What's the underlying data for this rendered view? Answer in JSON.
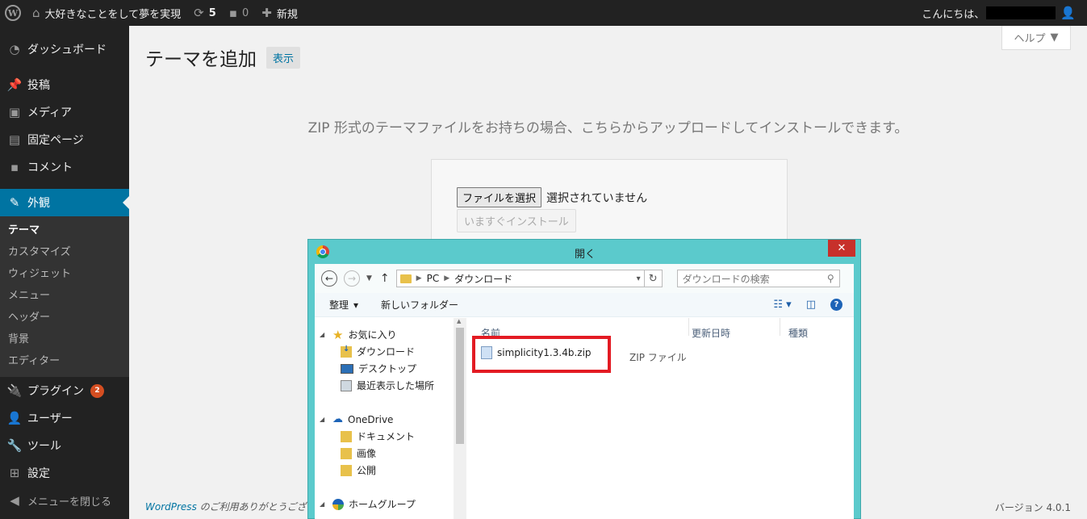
{
  "adminbar": {
    "site_name": "大好きなことをして夢を実現",
    "updates_count": "5",
    "comments_count": "0",
    "new_label": "新規",
    "greeting": "こんにちは、"
  },
  "sidebar": {
    "items": [
      {
        "label": "ダッシュボード",
        "icon": "dashboard-icon"
      },
      {
        "label": "投稿",
        "icon": "pin-icon"
      },
      {
        "label": "メディア",
        "icon": "media-icon"
      },
      {
        "label": "固定ページ",
        "icon": "page-icon"
      },
      {
        "label": "コメント",
        "icon": "comment-icon"
      },
      {
        "label": "外観",
        "icon": "brush-icon"
      },
      {
        "label": "プラグイン",
        "icon": "plugin-icon",
        "badge": "2"
      },
      {
        "label": "ユーザー",
        "icon": "user-icon"
      },
      {
        "label": "ツール",
        "icon": "wrench-icon"
      },
      {
        "label": "設定",
        "icon": "settings-icon"
      }
    ],
    "submenu": [
      "テーマ",
      "カスタマイズ",
      "ウィジェット",
      "メニュー",
      "ヘッダー",
      "背景",
      "エディター"
    ],
    "collapse": "メニューを閉じる"
  },
  "main": {
    "help_label": "ヘルプ",
    "title": "テーマを追加",
    "title_action": "表示",
    "upload_desc": "ZIP 形式のテーマファイルをお持ちの場合、こちらからアップロードしてインストールできます。",
    "choose_file": "ファイルを選択",
    "no_file": "選択されていません",
    "install_now": "いますぐインストール",
    "footer_wp": "WordPress",
    "footer_thanks": " のご利用ありがとうござい",
    "version": "バージョン 4.0.1"
  },
  "dialog": {
    "title": "開く",
    "path": [
      "PC",
      "ダウンロード"
    ],
    "search_placeholder": "ダウンロードの検索",
    "organize": "整理",
    "new_folder": "新しいフォルダー",
    "tree": [
      {
        "label": "お気に入り",
        "icon": "star-icon",
        "level": 0
      },
      {
        "label": "ダウンロード",
        "icon": "downloads-folder-icon",
        "level": 1
      },
      {
        "label": "デスクトップ",
        "icon": "desktop-icon",
        "level": 1
      },
      {
        "label": "最近表示した場所",
        "icon": "recent-places-icon",
        "level": 1
      },
      {
        "label": "OneDrive",
        "icon": "onedrive-icon",
        "level": 0
      },
      {
        "label": "ドキュメント",
        "icon": "folder-icon",
        "level": 1
      },
      {
        "label": "画像",
        "icon": "folder-icon",
        "level": 1
      },
      {
        "label": "公開",
        "icon": "folder-icon",
        "level": 1
      },
      {
        "label": "ホームグループ",
        "icon": "homegroup-icon",
        "level": 0
      }
    ],
    "columns": [
      "名前",
      "更新日時",
      "種類"
    ],
    "file": {
      "name": "simplicity1.3.4b.zip",
      "type": "ZIP ファイル"
    },
    "highlight_color": "#e31b23"
  }
}
